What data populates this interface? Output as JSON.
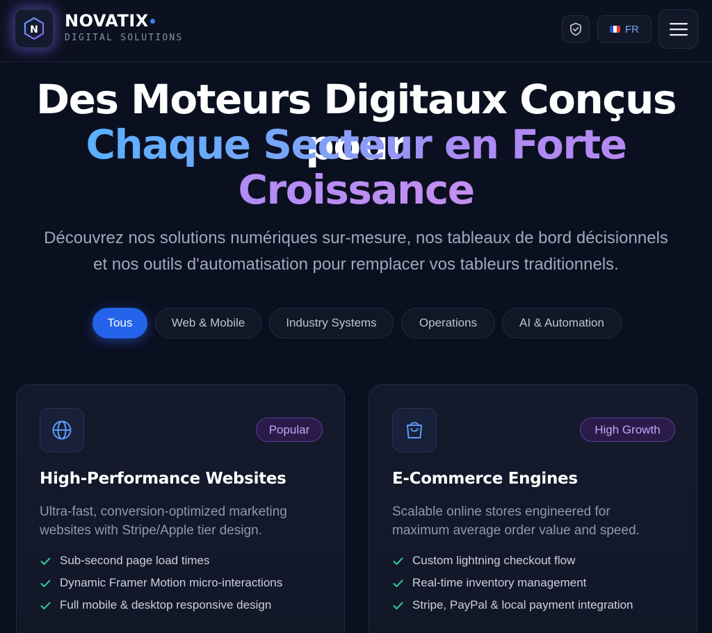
{
  "header": {
    "brand_name": "NOVATIX",
    "brand_tagline": "DIGITAL SOLUTIONS",
    "logo_letter": "N",
    "language_label": "FR",
    "language_flag": "france-flag-icon"
  },
  "hero": {
    "title_line1": "Des Moteurs Digitaux Conçus pour",
    "title_line2": "Chaque Secteur en Forte",
    "title_line3": "Croissance",
    "subtitle_line1": "Découvrez nos solutions numériques sur-mesure, nos tableaux de bord décisionnels",
    "subtitle_line2": "et nos outils d'automatisation pour remplacer vos tableurs traditionnels."
  },
  "tabs": [
    {
      "label": "Tous",
      "active": true
    },
    {
      "label": "Web & Mobile",
      "active": false
    },
    {
      "label": "Industry Systems",
      "active": false
    },
    {
      "label": "Operations",
      "active": false
    },
    {
      "label": "AI & Automation",
      "active": false
    }
  ],
  "cards": [
    {
      "icon": "globe-icon",
      "badge": "Popular",
      "title": "High-Performance Websites",
      "desc_line1": "Ultra-fast, conversion-optimized marketing",
      "desc_line2": "websites with Stripe/Apple tier design.",
      "features": [
        "Sub-second page load times",
        "Dynamic Framer Motion micro-interactions",
        "Full mobile & desktop responsive design"
      ]
    },
    {
      "icon": "shopping-bag-icon",
      "badge": "High Growth",
      "title": "E-Commerce Engines",
      "desc_line1": "Scalable online stores engineered for",
      "desc_line2": "maximum average order value and speed.",
      "features": [
        "Custom lightning checkout flow",
        "Real-time inventory management",
        "Stripe, PayPal & local payment integration"
      ]
    }
  ],
  "colors": {
    "background": "#0b1020",
    "accent_blue": "#2563eb",
    "badge_purple": "#c4a4f6",
    "check_green": "#34d399"
  }
}
